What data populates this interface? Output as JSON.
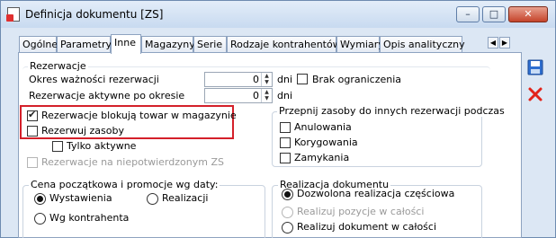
{
  "window": {
    "title": "Definicja dokumentu [ZS]",
    "controls": {
      "minimize": "–",
      "maximize": "□",
      "close": "✕"
    }
  },
  "tabs": [
    {
      "label": "Ogólne",
      "active": false
    },
    {
      "label": "Parametry",
      "active": false
    },
    {
      "label": "Inne",
      "active": true
    },
    {
      "label": "Magazyny",
      "active": false
    },
    {
      "label": "Serie",
      "active": false
    },
    {
      "label": "Rodzaje kontrahentów",
      "active": false
    },
    {
      "label": "Wymiary",
      "active": false
    },
    {
      "label": "Opis analityczny",
      "active": false
    }
  ],
  "tab_scroll": {
    "left": "◀",
    "right": "▶"
  },
  "reservation": {
    "title": "Rezerwacje",
    "validity_label": "Okres ważności rezerwacji",
    "validity_value": "0",
    "validity_unit": "dni",
    "active_after_label": "Rezerwacje aktywne po okresie",
    "active_after_value": "0",
    "active_after_unit": "dni",
    "no_limit_label": "Brak ograniczenia",
    "no_limit_checked": false,
    "block_goods_label": "Rezerwacje blokują towar w magazynie",
    "block_goods_checked": true,
    "reserve_resources_label": "Rezerwuj zasoby",
    "reserve_resources_checked": false,
    "only_active_label": "Tylko aktywne",
    "only_active_checked": false,
    "unconfirmed_label": "Rezerwacje na niepotwierdzonym ZS",
    "unconfirmed_checked": false
  },
  "reattach": {
    "title": "Przepnij zasoby do innych rezerwacji podczas",
    "options": [
      {
        "label": "Anulowania",
        "checked": false
      },
      {
        "label": "Korygowania",
        "checked": false
      },
      {
        "label": "Zamykania",
        "checked": false
      }
    ]
  },
  "price": {
    "title": "Cena początkowa i promocje wg daty:",
    "options": [
      {
        "label": "Wystawienia",
        "selected": true
      },
      {
        "label": "Realizacji",
        "selected": false
      },
      {
        "label": "Wg kontrahenta",
        "selected": false
      }
    ]
  },
  "realization": {
    "title": "Realizacja dokumentu",
    "options": [
      {
        "label": "Dozwolona realizacja częściowa",
        "selected": true,
        "enabled": true
      },
      {
        "label": "Realizuj pozycje w całości",
        "selected": false,
        "enabled": false
      },
      {
        "label": "Realizuj dokument w całości",
        "selected": false,
        "enabled": true
      }
    ]
  },
  "side_buttons": {
    "save": "save-icon",
    "cancel": "cancel-icon"
  },
  "colors": {
    "highlight": "#d4202a",
    "frame": "#dce7f4",
    "cancel_red": "#e2231a",
    "save_blue": "#2f6fd0"
  }
}
